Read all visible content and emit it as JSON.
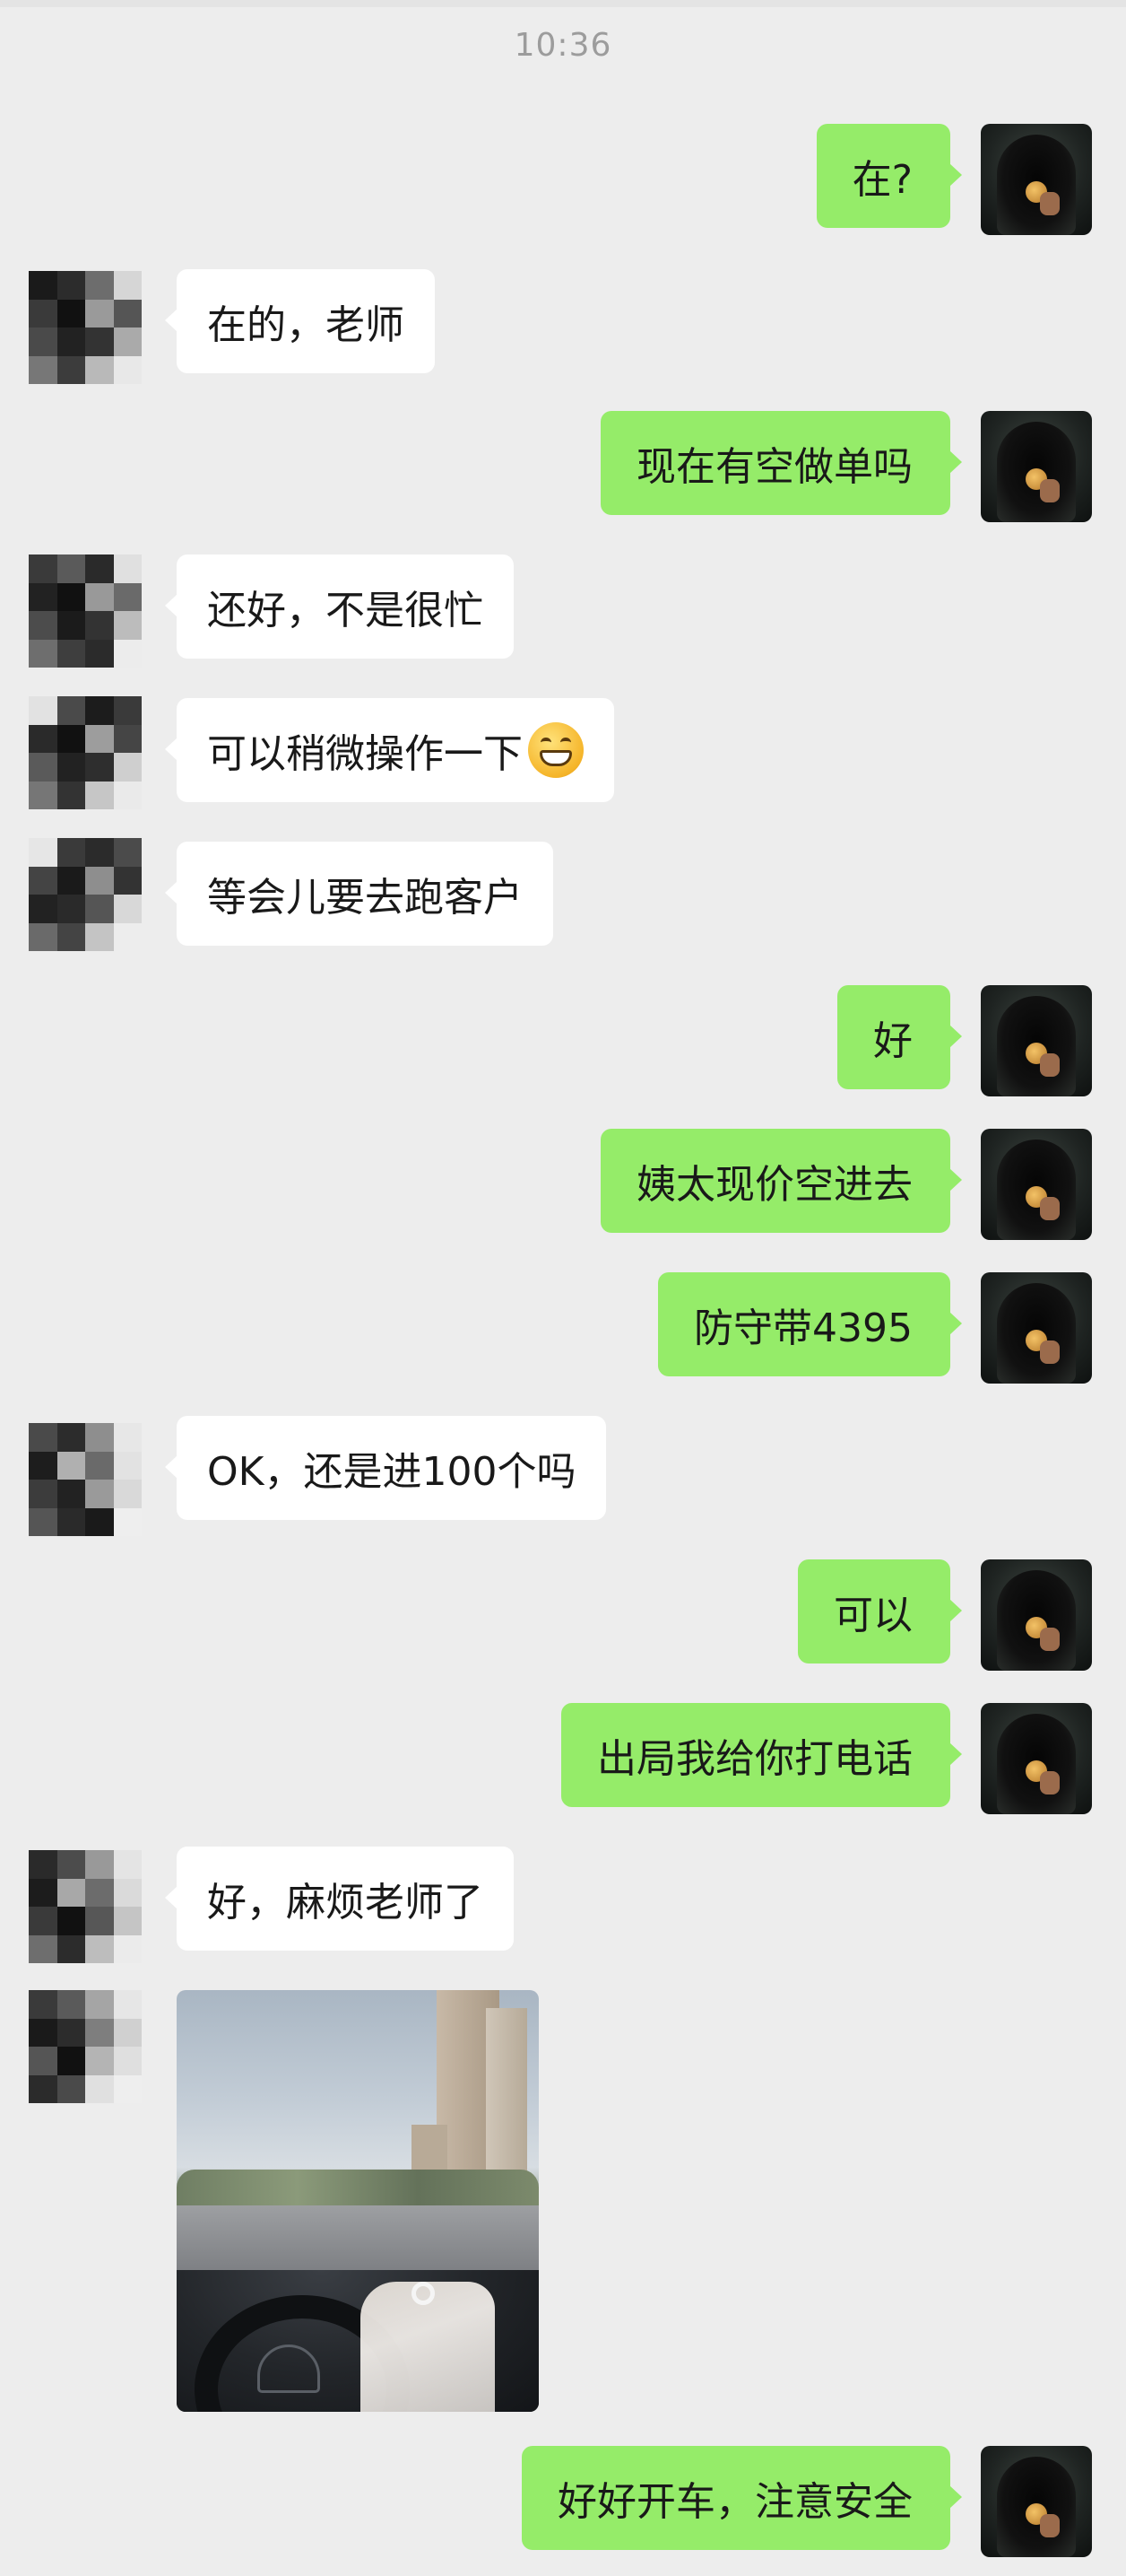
{
  "chat": {
    "time": "10:36",
    "messages": [
      {
        "side": "out",
        "text": "在?"
      },
      {
        "side": "in",
        "text": "在的，老师"
      },
      {
        "side": "out",
        "text": "现在有空做单吗"
      },
      {
        "side": "in",
        "text": "还好，不是很忙"
      },
      {
        "side": "in",
        "text": "可以稍微操作一下",
        "emoji": "grinning-face-emoji"
      },
      {
        "side": "in",
        "text": "等会儿要去跑客户"
      },
      {
        "side": "out",
        "text": "好"
      },
      {
        "side": "out",
        "text": "姨太现价空进去"
      },
      {
        "side": "out",
        "text": "防守带4395"
      },
      {
        "side": "in",
        "text": "OK，还是进100个吗"
      },
      {
        "side": "out",
        "text": "可以"
      },
      {
        "side": "out",
        "text": "出局我给你打电话"
      },
      {
        "side": "in",
        "text": "好，麻烦老师了"
      },
      {
        "side": "in",
        "type": "image",
        "image": "car-driving-photo"
      },
      {
        "side": "out",
        "text": "好好开车，注意安全"
      }
    ]
  },
  "colors": {
    "background": "#ededed",
    "outgoing_bubble": "#95ec69",
    "incoming_bubble": "#ffffff"
  },
  "icons": {
    "self_avatar": "hooded-figure-coin-avatar",
    "contact_avatar": "pixelated-avatar"
  }
}
